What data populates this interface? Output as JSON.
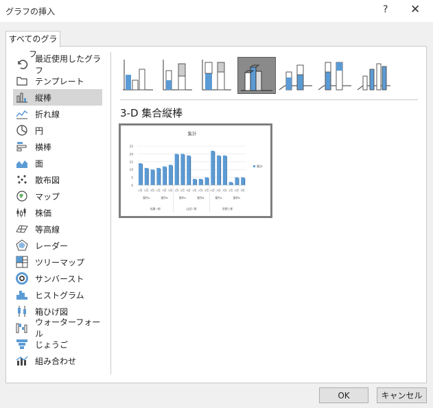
{
  "window": {
    "title": "グラフの挿入",
    "help_label": "?",
    "close_label": "✕"
  },
  "tab": {
    "label": "すべてのグラフ"
  },
  "sidebar": {
    "items": [
      {
        "label": "最近使用したグラフ",
        "icon": "recent-icon"
      },
      {
        "label": "テンプレート",
        "icon": "folder-icon"
      },
      {
        "label": "縦棒",
        "icon": "column-chart-icon",
        "selected": true
      },
      {
        "label": "折れ線",
        "icon": "line-chart-icon"
      },
      {
        "label": "円",
        "icon": "pie-chart-icon"
      },
      {
        "label": "横棒",
        "icon": "bar-chart-icon"
      },
      {
        "label": "面",
        "icon": "area-chart-icon"
      },
      {
        "label": "散布図",
        "icon": "scatter-chart-icon"
      },
      {
        "label": "マップ",
        "icon": "map-chart-icon"
      },
      {
        "label": "株価",
        "icon": "stock-chart-icon"
      },
      {
        "label": "等高線",
        "icon": "surface-chart-icon"
      },
      {
        "label": "レーダー",
        "icon": "radar-chart-icon"
      },
      {
        "label": "ツリーマップ",
        "icon": "treemap-icon"
      },
      {
        "label": "サンバースト",
        "icon": "sunburst-icon"
      },
      {
        "label": "ヒストグラム",
        "icon": "histogram-icon"
      },
      {
        "label": "箱ひげ図",
        "icon": "box-whisker-icon"
      },
      {
        "label": "ウォーターフォール",
        "icon": "waterfall-icon"
      },
      {
        "label": "じょうご",
        "icon": "funnel-icon"
      },
      {
        "label": "組み合わせ",
        "icon": "combo-chart-icon"
      }
    ]
  },
  "chart_types": [
    {
      "icon": "clustered-column-icon"
    },
    {
      "icon": "stacked-column-icon"
    },
    {
      "icon": "100-stacked-column-icon"
    },
    {
      "icon": "3d-clustered-column-icon",
      "selected": true
    },
    {
      "icon": "3d-stacked-column-icon"
    },
    {
      "icon": "3d-100-stacked-column-icon"
    },
    {
      "icon": "3d-column-icon"
    }
  ],
  "subtitle": "3-D 集合縦棒",
  "colors": {
    "accent": "#5b9bd5",
    "selected_bg": "#8a8a8a"
  },
  "chart_data": {
    "type": "bar",
    "title": "集計",
    "categories": [
      "1月",
      "2月",
      "3月",
      "1月",
      "2月",
      "3月",
      "1月",
      "2月",
      "3月",
      "1月",
      "2月",
      "3月",
      "1月",
      "2月",
      "3月",
      "1月",
      "2月",
      "3月"
    ],
    "group_labels": [
      "案件A",
      "案件B",
      "案件A",
      "案件B",
      "案件A",
      "案件B"
    ],
    "person_labels": [
      "佐藤一郎",
      "山田二郎",
      "鈴野三郎"
    ],
    "series": [
      {
        "name": "集計",
        "values": [
          14,
          11,
          10,
          11,
          12,
          13,
          20,
          20,
          19,
          4,
          4,
          5,
          22,
          19,
          19,
          2,
          5,
          5
        ]
      }
    ],
    "y_ticks": [
      "25",
      "20",
      "15",
      "10",
      "5",
      "0"
    ],
    "ylim": [
      0,
      25
    ],
    "legend_position": "right",
    "grid": true
  },
  "buttons": {
    "ok": "OK",
    "cancel": "キャンセル"
  }
}
